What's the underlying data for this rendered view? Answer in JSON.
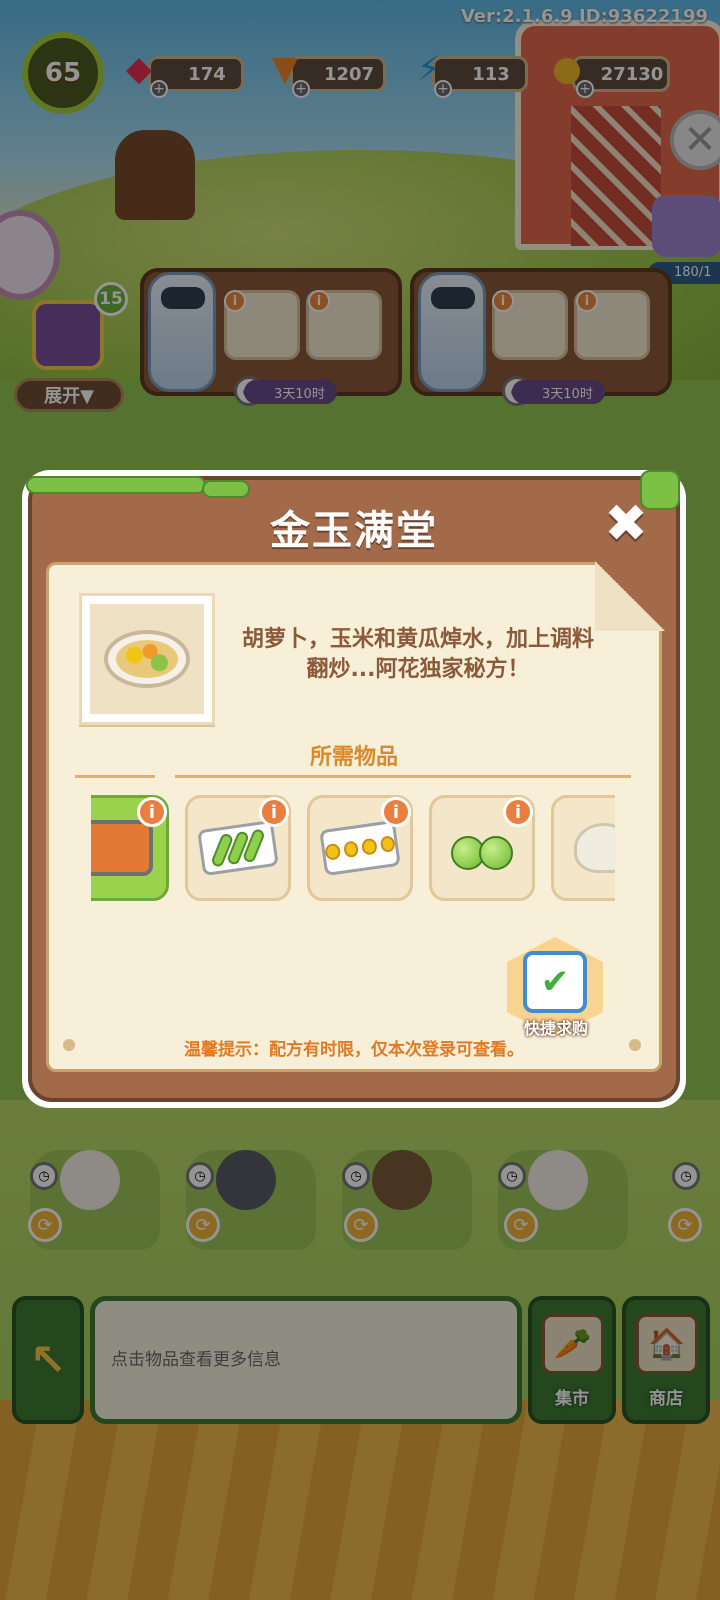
{
  "hud": {
    "version": "Ver:2.1.6.9 ID:93622199",
    "level": "65",
    "gems": "174",
    "carrots": "1207",
    "energy": "113",
    "coins": "27130",
    "side_count": "180/1"
  },
  "orders": {
    "chest_count": "15",
    "expand_label": "展开▼",
    "timer_1": "3天10时",
    "timer_2": "3天10时"
  },
  "dialog": {
    "title": "金玉满堂",
    "close_symbol": "✖",
    "description": "胡萝卜，玉米和黄瓜焯水，加上调料翻炒...阿花独家秘方！",
    "required_title": "所需物品",
    "info_symbol": "i",
    "items": [
      {
        "name": "grill",
        "selected": true
      },
      {
        "name": "cucumber-tray",
        "selected": false
      },
      {
        "name": "corn-tray",
        "selected": false
      },
      {
        "name": "limes",
        "selected": false
      },
      {
        "name": "garlic",
        "selected": false
      }
    ],
    "quick_buy_label": "快捷求购",
    "tip": "温馨提示：配方有时限，仅本次登录可查看。"
  },
  "bottom": {
    "info_text": "点击物品查看更多信息",
    "market_label": "集市",
    "shop_label": "商店"
  },
  "colors": {
    "dialog_brown": "#a26a48",
    "paper": "#f8efd9",
    "accent_orange": "#e07a24",
    "bar_green": "#3f7a35"
  },
  "icons": {
    "gem": "gem-icon",
    "carrot": "carrot-icon",
    "energy": "lightning-icon",
    "coin": "coin-icon",
    "back": "back-arrow-icon"
  }
}
